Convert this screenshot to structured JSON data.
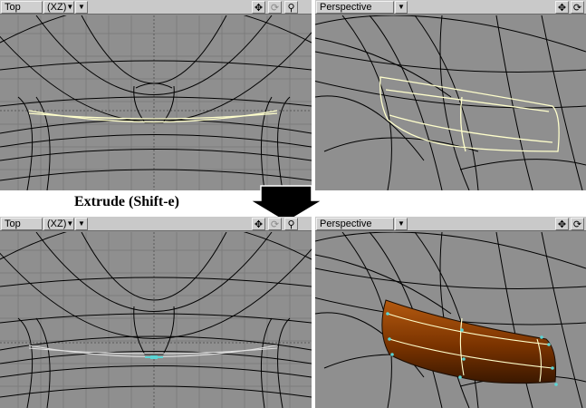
{
  "caption": "Extrude (Shift-e)",
  "viewports": {
    "top_left": {
      "view": "Top",
      "axis": "(XZ)",
      "tools": [
        "move-icon",
        "rotate-icon",
        "zoom-icon"
      ]
    },
    "top_right": {
      "view": "Perspective",
      "tools": [
        "move-icon",
        "rotate-icon"
      ]
    },
    "bottom_left": {
      "view": "Top",
      "axis": "(XZ)",
      "tools": [
        "move-icon",
        "rotate-icon",
        "zoom-icon"
      ]
    },
    "bottom_right": {
      "view": "Perspective",
      "tools": [
        "move-icon",
        "rotate-icon"
      ]
    }
  },
  "colors": {
    "viewport_bg": "#8f8f8f",
    "wire": "#000000",
    "selected": "#ffffcc",
    "extruded_fill": "#8a3a00",
    "points": "#5ad4d4"
  }
}
